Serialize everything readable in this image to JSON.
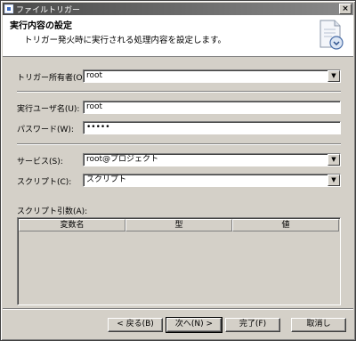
{
  "window": {
    "title": "ファイルトリガー",
    "close_symbol": "×"
  },
  "header": {
    "title": "実行内容の設定",
    "description": "トリガー発火時に実行される処理内容を設定します。"
  },
  "form": {
    "owner": {
      "label": "トリガー所有者(O):",
      "value": "root"
    },
    "exec_user": {
      "label": "実行ユーザ名(U):",
      "value": "root"
    },
    "password": {
      "label": "パスワード(W):",
      "value": "•••••"
    },
    "service": {
      "label": "サービス(S):",
      "value": "root@プロジェクト"
    },
    "script": {
      "label": "スクリプト(C):",
      "value": "スクリプト"
    },
    "args": {
      "label": "スクリプト引数(A):",
      "columns": [
        "変数名",
        "型",
        "値"
      ]
    }
  },
  "buttons": {
    "back": "< 戻る(B)",
    "next": "次へ(N) >",
    "finish": "完了(F)",
    "cancel": "取消し"
  },
  "icons": {
    "dropdown_arrow": "▼"
  }
}
